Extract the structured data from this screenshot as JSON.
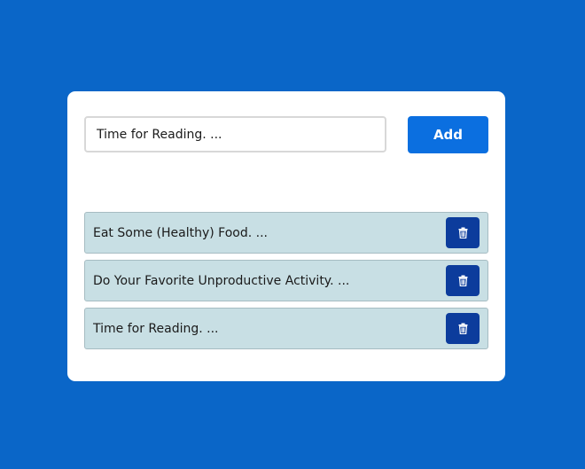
{
  "form": {
    "input_value": "Time for Reading. ...",
    "add_label": "Add"
  },
  "tasks": [
    {
      "text": "Eat Some (Healthy) Food. ...",
      "action_icon": "trash-icon"
    },
    {
      "text": "Do Your Favorite Unproductive Activity. ...",
      "action_icon": "trash-icon"
    },
    {
      "text": "Time for Reading. ...",
      "action_icon": "trash-icon"
    }
  ],
  "colors": {
    "background": "#0a66c8",
    "card": "#ffffff",
    "add_button": "#0b6fe0",
    "task_item": "#c8dfe4",
    "delete_button": "#0c3c9c"
  }
}
